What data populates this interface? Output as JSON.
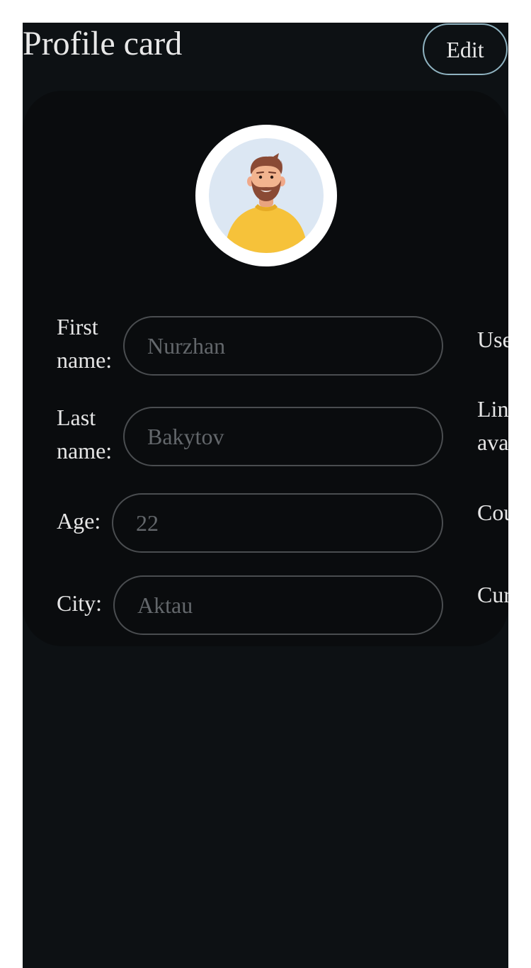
{
  "header": {
    "title": "Profile card",
    "edit_label": "Edit"
  },
  "avatar": {
    "icon": "user-avatar-illustration",
    "colors": {
      "ring": "#ffffff",
      "background": "#dce7f3",
      "sweater": "#f6c23a",
      "skin": "#f2b48f",
      "hair": "#8a4a35"
    }
  },
  "form": {
    "left": [
      {
        "label": "First\nname:",
        "value": "Nurzhan"
      },
      {
        "label": "Last\nname:",
        "value": "Bakytov"
      },
      {
        "label": "Age:",
        "value": "22"
      },
      {
        "label": "City:",
        "value": "Aktau"
      }
    ],
    "right": [
      {
        "label": "Usern"
      },
      {
        "label": "Link t\navatar"
      },
      {
        "label": "Count"
      },
      {
        "label": "Curren"
      }
    ]
  },
  "colors": {
    "page_background": "#0d1114",
    "card_background": "#0a0c0e",
    "edit_border": "#8fb3c1",
    "input_border": "#4a4d50",
    "text": "#e6e6e6",
    "placeholder": "#63676b"
  }
}
